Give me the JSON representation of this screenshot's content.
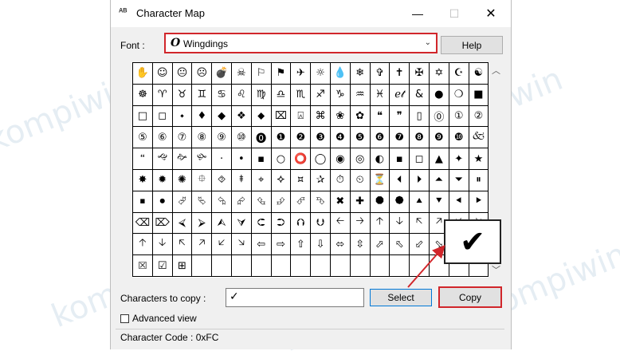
{
  "window": {
    "title": "Character Map",
    "app_icon": "character-map-icon"
  },
  "font": {
    "label": "Font :",
    "selected": "Wingdings",
    "help_label": "Help"
  },
  "grid": {
    "rows": [
      [
        "✋",
        "☺",
        "😐",
        "☹",
        "💣",
        "☠",
        "⚐",
        "⚑",
        "✈",
        "☼",
        "💧",
        "❄",
        "✞",
        "✝",
        "✠",
        "✡",
        "☪",
        "☯"
      ],
      [
        "☸",
        "♈",
        "♉",
        "♊",
        "♋",
        "♌",
        "♍",
        "♎",
        "♏",
        "♐",
        "♑",
        "♒",
        "♓",
        "ℯ𝓉",
        "&",
        "●",
        "❍",
        "■"
      ],
      [
        "□",
        "◻",
        "⬩",
        "♦",
        "◆",
        "❖",
        "⬥",
        "⌧",
        "⍓",
        "⌘",
        "❀",
        "✿",
        "❝",
        "❞",
        "▯",
        "⓪",
        "①",
        "②"
      ],
      [
        "⑤",
        "⑥",
        "⑦",
        "⑧",
        "⑨",
        "⑩",
        "⓿",
        "❶",
        "❷",
        "❸",
        "❹",
        "❺",
        "❻",
        "❼",
        "❽",
        "❾",
        "❿",
        "🙵"
      ],
      [
        "🙶",
        "🙙",
        "🙚",
        "🙛",
        "·",
        "•",
        "▪",
        "○",
        "⭕",
        "◯",
        "◉",
        "◎",
        "◐",
        "▪",
        "◻",
        "▲",
        "✦",
        "★"
      ],
      [
        "✸",
        "✹",
        "✺",
        "⯐",
        "⯑",
        "⯒",
        "⌖",
        "⯎",
        "⯏",
        "✰",
        "⏱",
        "⏲",
        "⏳",
        "⏴",
        "⏵",
        "⏶",
        "⏷",
        "⏸"
      ],
      [
        "⏹",
        "⏺",
        "⮰",
        "⮱",
        "⮲",
        "⮳",
        "⮴",
        "⮵",
        "⮶",
        "⮷",
        "✖",
        "✚",
        "⯃",
        "⯄",
        "⯅",
        "⯆",
        "⯇",
        "⯈"
      ],
      [
        "⌫",
        "⌦",
        "⮘",
        "⮚",
        "⮙",
        "⮛",
        "⮈",
        "⮊",
        "⮉",
        "⮋",
        "🡠",
        "🡢",
        "🡡",
        "🡣",
        "🡤",
        "🡥",
        "🡧",
        "🡦"
      ],
      [
        "🡡",
        "🡣",
        "🡤",
        "🡥",
        "🡧",
        "🡦",
        "⇦",
        "⇨",
        "⇧",
        "⇩",
        "⬄",
        "⇳",
        "⬀",
        "⬁",
        "⬃",
        "⬂",
        "▭",
        "▫"
      ],
      [
        "⮽",
        "☑",
        "⊞",
        "",
        "",
        "",
        "",
        "",
        "",
        "",
        "",
        "",
        "",
        "",
        "",
        "",
        "",
        ""
      ]
    ]
  },
  "zoom_char": "✔",
  "copy": {
    "label": "Characters to copy :",
    "value": "✓",
    "select_label": "Select",
    "copy_label": "Copy"
  },
  "advanced": {
    "label": "Advanced view"
  },
  "status": {
    "text": "Character Code : 0xFC"
  },
  "colors": {
    "highlight": "#d1262b",
    "select_border": "#0078d7",
    "watermark": "#c6d8e6"
  },
  "watermark_text": "kompiwin"
}
